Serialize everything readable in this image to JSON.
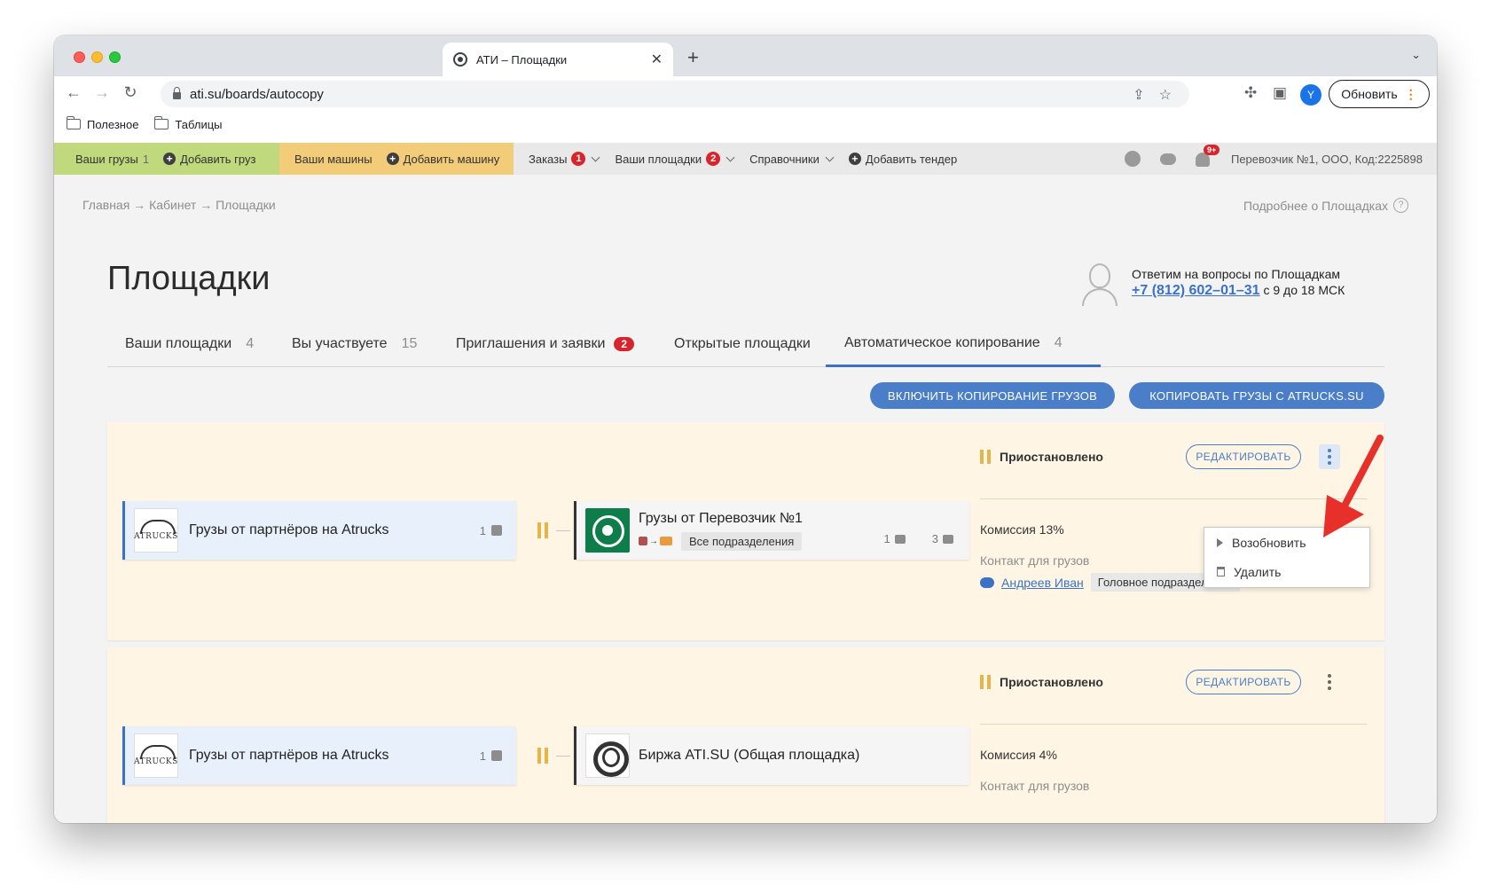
{
  "browser": {
    "tab_title": "АТИ – Площадки",
    "url": "ati.su/boards/autocopy",
    "update_label": "Обновить",
    "profile_letter": "Y",
    "bookmarks": [
      "Полезное",
      "Таблицы"
    ]
  },
  "site_nav": {
    "cargo_label": "Ваши грузы",
    "cargo_count": "1",
    "add_cargo": "Добавить груз",
    "trucks_label": "Ваши машины",
    "add_truck": "Добавить машину",
    "orders_label": "Заказы",
    "orders_badge": "1",
    "boards_label": "Ваши площадки",
    "boards_badge": "2",
    "refs_label": "Справочники",
    "add_tender": "Добавить тендер",
    "notif_badge": "9+",
    "company": "Перевозчик №1, ООО,  Код:2225898"
  },
  "page": {
    "breadcrumb": "Главная → Кабинет → Площадки",
    "more_link": "Подробнее о Площадках",
    "title": "Площадки",
    "support_line": "Ответим на вопросы по Площадкам",
    "support_phone": "+7 (812) 602–01–31",
    "support_hours": "с 9 до 18 МСК"
  },
  "tabs": [
    {
      "label": "Ваши площадки",
      "count": "4"
    },
    {
      "label": "Вы участвуете",
      "count": "15"
    },
    {
      "label": "Приглашения и заявки",
      "badge": "2"
    },
    {
      "label": "Открытые площадки"
    },
    {
      "label": "Автоматическое копирование",
      "count": "4"
    }
  ],
  "actions": {
    "enable_copy": "ВКЛЮЧИТЬ КОПИРОВАНИЕ ГРУЗОВ",
    "copy_from": "КОПИРОВАТЬ ГРУЗЫ С ATRUCKS.SU"
  },
  "cards": [
    {
      "source_logo_text": "ATRUCKS",
      "source": "Грузы от партнёров на Atrucks",
      "source_count": "1",
      "target": "Грузы от Перевозчик №1",
      "target_dept": "Все подразделения",
      "target_cargo_count": "1",
      "target_members": "3",
      "status": "Приостановлено",
      "edit": "РЕДАКТИРОВАТЬ",
      "commission": "Комиссия 13%",
      "contact_label": "Контакт для грузов",
      "contact_name": "Андреев Иван",
      "contact_dept": "Головное подразделение"
    },
    {
      "source_logo_text": "ATRUCKS",
      "source": "Грузы от партнёров на Atrucks",
      "source_count": "1",
      "target": "Биржа ATI.SU (Общая площадка)",
      "status": "Приостановлено",
      "edit": "РЕДАКТИРОВАТЬ",
      "commission": "Комиссия 4%",
      "contact_label": "Контакт для грузов"
    }
  ],
  "menu": {
    "resume": "Возобновить",
    "delete": "Удалить"
  },
  "colors": {
    "accent": "#4a7ec9",
    "annotation_arrow": "#e8302a",
    "paused": "#e4b54a"
  }
}
